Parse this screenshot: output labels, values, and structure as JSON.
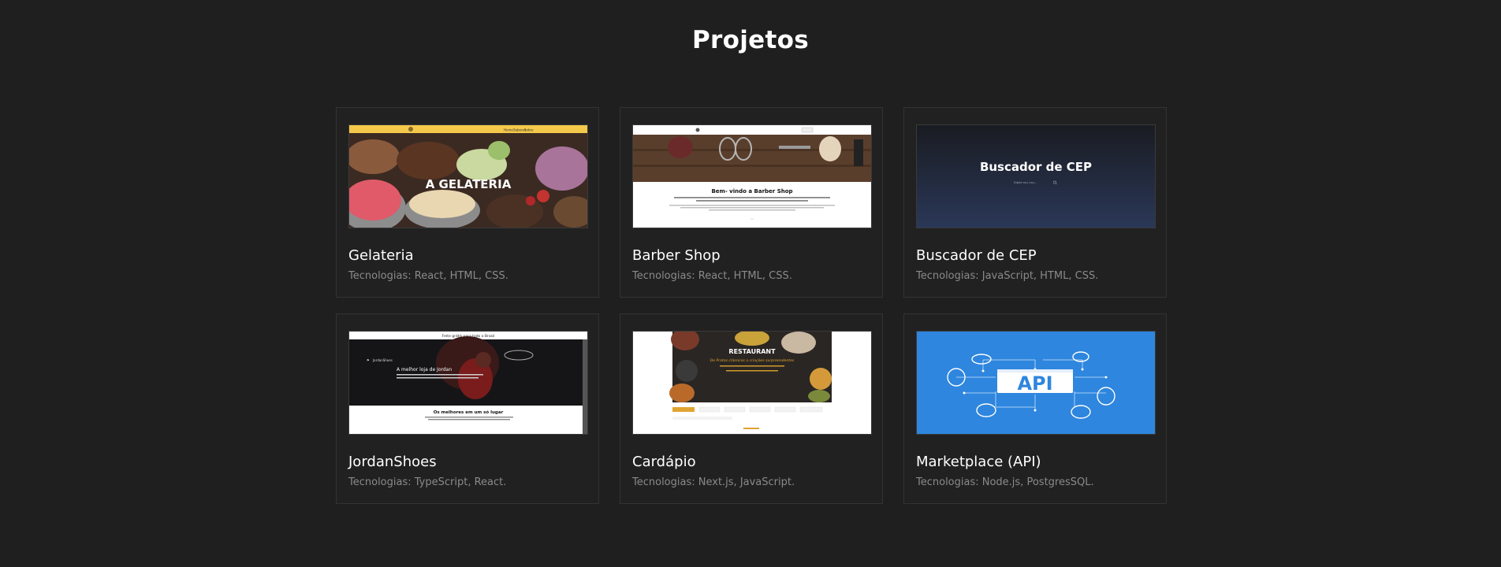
{
  "section": {
    "title": "Projetos"
  },
  "projects": [
    {
      "name": "Gelateria",
      "tech": "Tecnologias: React, HTML, CSS.",
      "preview": {
        "kind": "gelateria",
        "nav": [
          "Home",
          "Sabores",
          "Sobre"
        ],
        "hero_text": "A GELATERIA",
        "colors": {
          "bar": "#f4c84a"
        }
      }
    },
    {
      "name": "Barber Shop",
      "tech": "Tecnologias: React, HTML, CSS.",
      "preview": {
        "kind": "barber",
        "heading": "Bem- vindo a Barber Shop"
      }
    },
    {
      "name": "Buscador de CEP",
      "tech": "Tecnologias: JavaScript, HTML, CSS.",
      "preview": {
        "kind": "cep",
        "heading": "Buscador de CEP",
        "placeholder": "Digite seu cep..."
      }
    },
    {
      "name": "JordanShoes",
      "tech": "Tecnologias: TypeScript, React.",
      "preview": {
        "kind": "jordan",
        "top_bar": "Frete grátis para todo o Brasil",
        "brand": "JordanShoes",
        "hero_text": "A melhor loja de Jordan",
        "section_text": "Os melhores em um só lugar"
      }
    },
    {
      "name": "Cardápio",
      "tech": "Tecnologias: Next.js, JavaScript.",
      "preview": {
        "kind": "cardapio",
        "heading": "RESTAURANT",
        "tagline": "De Pratos clássicos a criações surpreendentes"
      }
    },
    {
      "name": "Marketplace (API)",
      "tech": "Tecnologias: Node.js, PostgresSQL.",
      "preview": {
        "kind": "api",
        "label": "API",
        "colors": {
          "bg": "#2e86de"
        }
      }
    }
  ]
}
